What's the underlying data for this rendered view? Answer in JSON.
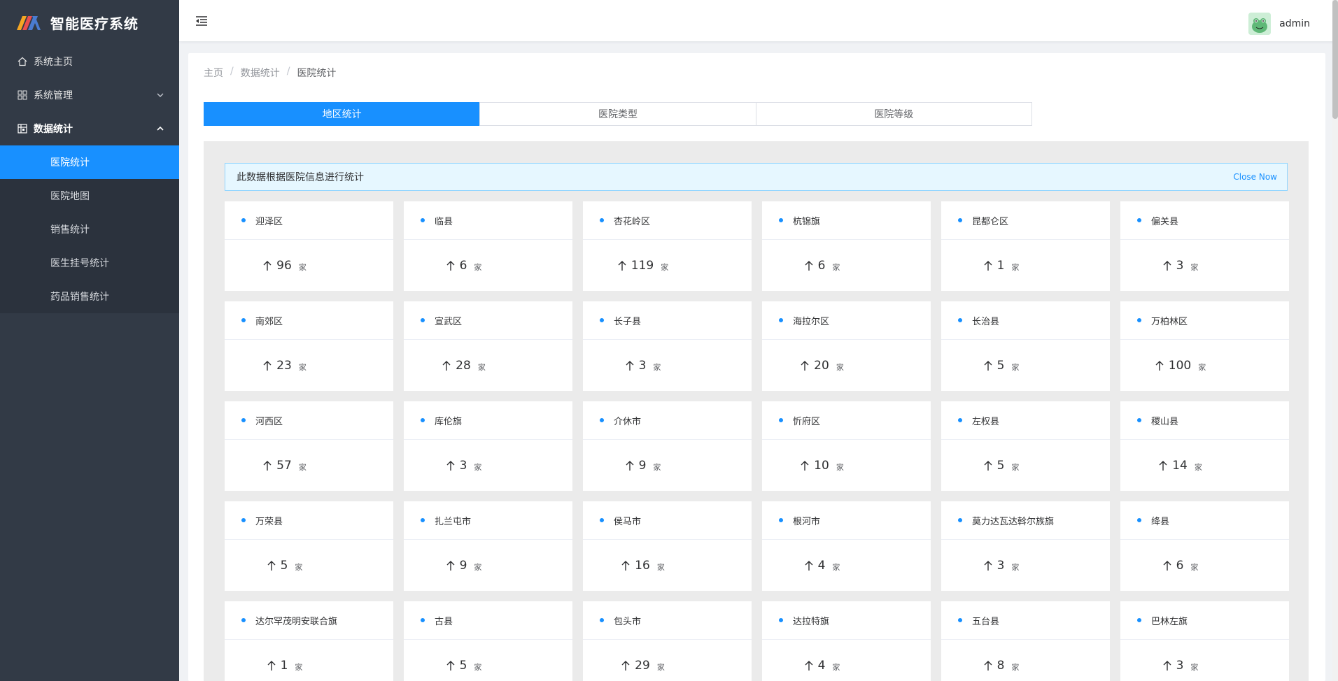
{
  "app": {
    "title": "智能医疗系统"
  },
  "sidebar": {
    "items": [
      {
        "label": "系统主页",
        "icon": "home-icon"
      },
      {
        "label": "系统管理",
        "icon": "grid-icon"
      },
      {
        "label": "数据统计",
        "icon": "table-icon"
      }
    ],
    "subitems": [
      {
        "label": "医院统计",
        "active": true
      },
      {
        "label": "医院地图"
      },
      {
        "label": "销售统计"
      },
      {
        "label": "医生挂号统计"
      },
      {
        "label": "药品销售统计"
      }
    ]
  },
  "header": {
    "username": "admin"
  },
  "breadcrumb": [
    "主页",
    "数据统计",
    "医院统计"
  ],
  "tabs": [
    "地区统计",
    "医院类型",
    "医院等级"
  ],
  "alert": {
    "message": "此数据根据医院信息进行统计",
    "close_label": "Close Now"
  },
  "unit": "家",
  "colors": {
    "accent": "#1890ff",
    "sidebar": "#323a46"
  },
  "regions": [
    {
      "name": "迎泽区",
      "count": "96"
    },
    {
      "name": "临县",
      "count": "6"
    },
    {
      "name": "杏花岭区",
      "count": "119"
    },
    {
      "name": "杭锦旗",
      "count": "6"
    },
    {
      "name": "昆都仑区",
      "count": "1"
    },
    {
      "name": "偏关县",
      "count": "3"
    },
    {
      "name": "南郊区",
      "count": "23"
    },
    {
      "name": "宣武区",
      "count": "28"
    },
    {
      "name": "长子县",
      "count": "3"
    },
    {
      "name": "海拉尔区",
      "count": "20"
    },
    {
      "name": "长治县",
      "count": "5"
    },
    {
      "name": "万柏林区",
      "count": "100"
    },
    {
      "name": "河西区",
      "count": "57"
    },
    {
      "name": "库伦旗",
      "count": "3"
    },
    {
      "name": "介休市",
      "count": "9"
    },
    {
      "name": "忻府区",
      "count": "10"
    },
    {
      "name": "左权县",
      "count": "5"
    },
    {
      "name": "稷山县",
      "count": "14"
    },
    {
      "name": "万荣县",
      "count": "5"
    },
    {
      "name": "扎兰屯市",
      "count": "9"
    },
    {
      "name": "侯马市",
      "count": "16"
    },
    {
      "name": "根河市",
      "count": "4"
    },
    {
      "name": "莫力达瓦达斡尔族旗",
      "count": "3"
    },
    {
      "name": "绛县",
      "count": "6"
    },
    {
      "name": "达尔罕茂明安联合旗",
      "count": "1"
    },
    {
      "name": "古县",
      "count": "5"
    },
    {
      "name": "包头市",
      "count": "29"
    },
    {
      "name": "达拉特旗",
      "count": "4"
    },
    {
      "name": "五台县",
      "count": "8"
    },
    {
      "name": "巴林左旗",
      "count": "3"
    }
  ]
}
